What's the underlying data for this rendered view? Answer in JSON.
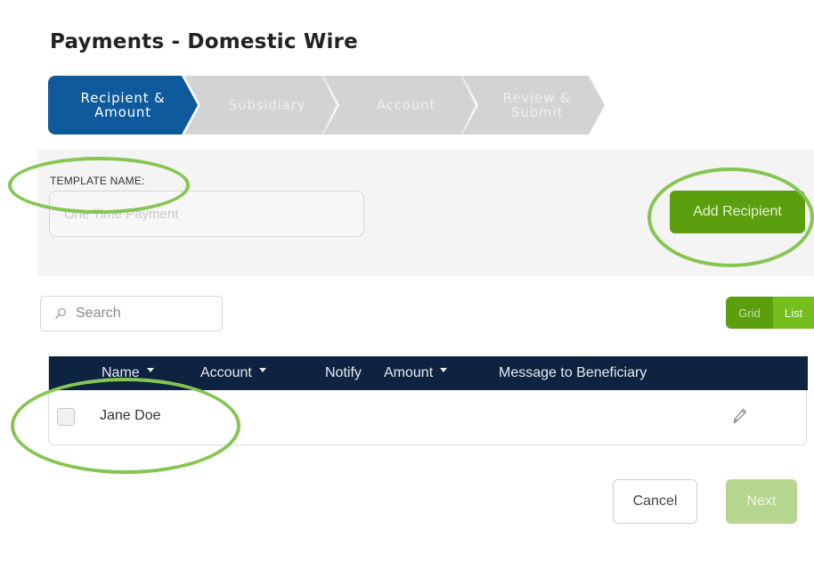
{
  "page": {
    "title": "Payments - Domestic Wire"
  },
  "stepper": {
    "steps": [
      {
        "label_line1": "Recipient &",
        "label_line2": "Amount",
        "state": "active"
      },
      {
        "label_line1": "Subsidiary",
        "label_line2": "",
        "state": "inactive"
      },
      {
        "label_line1": "Account",
        "label_line2": "",
        "state": "inactive"
      },
      {
        "label_line1": "Review &",
        "label_line2": "Submit",
        "state": "inactive"
      }
    ]
  },
  "template": {
    "label": "TEMPLATE NAME:",
    "placeholder": "One Time Payment",
    "value": ""
  },
  "actions": {
    "add_recipient_label": "Add Recipient"
  },
  "search": {
    "placeholder": "Search",
    "icon": "search-icon"
  },
  "view_toggle": {
    "grid_label": "Grid",
    "list_label": "List",
    "selected": "List"
  },
  "table": {
    "columns": [
      {
        "label": "Name",
        "sortable": true
      },
      {
        "label": "Account",
        "sortable": true
      },
      {
        "label": "Notify",
        "sortable": false
      },
      {
        "label": "Amount",
        "sortable": true
      },
      {
        "label": "Message to Beneficiary",
        "sortable": false
      }
    ],
    "rows": [
      {
        "name": "Jane Doe",
        "checked": false,
        "edit_icon": "pencil-icon"
      }
    ]
  },
  "footer": {
    "cancel_label": "Cancel",
    "next_label": "Next",
    "next_enabled": false
  },
  "colors": {
    "active_step": "#0f5a9c",
    "inactive_step": "#d3d3d3",
    "primary_green": "#5b9f0e",
    "header_navy": "#0d2340",
    "annotation": "#86c552"
  }
}
